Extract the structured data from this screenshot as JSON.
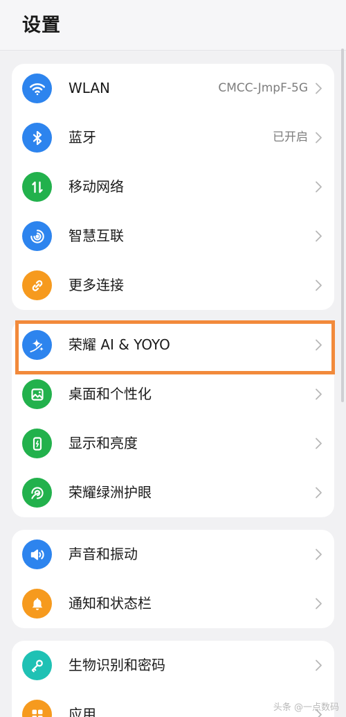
{
  "header": {
    "title": "设置"
  },
  "colors": {
    "blue": "#2d84ee",
    "green": "#22b14c",
    "orange": "#f69a1e",
    "teal": "#1fc1b4",
    "highlight": "#f28a3b"
  },
  "groups": [
    {
      "items": [
        {
          "label": "WLAN",
          "value": "CMCC-JmpF-5G",
          "icon": "wifi-icon",
          "color": "blue"
        },
        {
          "label": "蓝牙",
          "value": "已开启",
          "icon": "bluetooth-icon",
          "color": "blue"
        },
        {
          "label": "移动网络",
          "value": "",
          "icon": "mobile-data-icon",
          "color": "green"
        },
        {
          "label": "智慧互联",
          "value": "",
          "icon": "smart-connect-icon",
          "color": "blue"
        },
        {
          "label": "更多连接",
          "value": "",
          "icon": "link-icon",
          "color": "orange"
        }
      ]
    },
    {
      "items": [
        {
          "label": "荣耀 AI & YOYO",
          "value": "",
          "icon": "ai-sparkle-icon",
          "color": "blue",
          "highlighted": true
        },
        {
          "label": "桌面和个性化",
          "value": "",
          "icon": "wallpaper-icon",
          "color": "green"
        },
        {
          "label": "显示和亮度",
          "value": "",
          "icon": "display-brightness-icon",
          "color": "green"
        },
        {
          "label": "荣耀绿洲护眼",
          "value": "",
          "icon": "eye-comfort-icon",
          "color": "green"
        }
      ]
    },
    {
      "items": [
        {
          "label": "声音和振动",
          "value": "",
          "icon": "volume-icon",
          "color": "blue"
        },
        {
          "label": "通知和状态栏",
          "value": "",
          "icon": "bell-icon",
          "color": "orange"
        }
      ]
    },
    {
      "items": [
        {
          "label": "生物识别和密码",
          "value": "",
          "icon": "key-icon",
          "color": "teal"
        },
        {
          "label": "应用",
          "value": "",
          "icon": "apps-grid-icon",
          "color": "orange"
        }
      ]
    }
  ],
  "watermark": "头条 @一点数码"
}
